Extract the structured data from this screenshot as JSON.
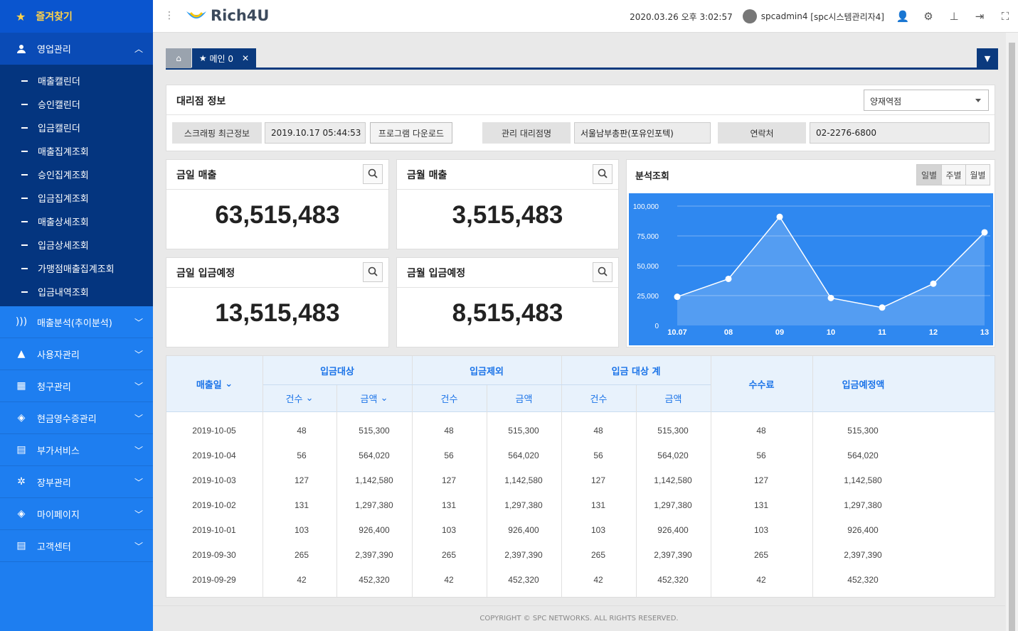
{
  "sidebar": {
    "favorites": "즐겨찾기",
    "sales": "영업관리",
    "sub": [
      "매출캘린더",
      "승인캘린더",
      "입금캘린더",
      "매출집계조회",
      "승인집계조회",
      "입금집계조회",
      "매출상세조회",
      "입금상세조회",
      "가맹점매출집계조회",
      "입금내역조회"
    ],
    "menus": [
      {
        "label": "매출분석(추이분석)",
        "icon": "signal-icon"
      },
      {
        "label": "사용자관리",
        "icon": "warning-icon"
      },
      {
        "label": "청구관리",
        "icon": "grid-icon"
      },
      {
        "label": "현금영수증관리",
        "icon": "tag-icon"
      },
      {
        "label": "부가서비스",
        "icon": "id-card-icon"
      },
      {
        "label": "장부관리",
        "icon": "gear-icon"
      },
      {
        "label": "마이페이지",
        "icon": "tag-icon"
      },
      {
        "label": "고객센터",
        "icon": "id-card-icon"
      }
    ]
  },
  "topbar": {
    "logo": "Rich4U",
    "datetime": "2020.03.26 오후 3:02:57",
    "user": "spcadmin4",
    "role": "[spc시스템관리자4]"
  },
  "tabs": {
    "main": "메인 0"
  },
  "agency": {
    "title": "대리점 정보",
    "select": "양재역점",
    "scrape_label": "스크래핑 최근정보",
    "scrape_value": "2019.10.17 05:44:53",
    "download": "프로그램 다운로드",
    "mgr_label": "관리 대리점명",
    "mgr_value": "서울남부총판(포유인포텍)",
    "contact_label": "연락처",
    "contact_value": "02-2276-6800"
  },
  "cards": [
    {
      "title": "금일 매출",
      "value": "63,515,483"
    },
    {
      "title": "금월 매출",
      "value": "3,515,483"
    },
    {
      "title": "금일 입금예정",
      "value": "13,515,483"
    },
    {
      "title": "금월 입금예정",
      "value": "8,515,483"
    }
  ],
  "analysis": {
    "title": "분석조회",
    "periods": [
      "일별",
      "주별",
      "월별"
    ]
  },
  "chart_data": {
    "type": "line",
    "categories": [
      "10.07",
      "08",
      "09",
      "10",
      "11",
      "12",
      "13"
    ],
    "values": [
      24000,
      39000,
      91000,
      23000,
      15000,
      35000,
      78000
    ],
    "ylim": [
      0,
      100000
    ],
    "yticks": [
      "100,000",
      "75,000",
      "50,000",
      "25,000",
      "0"
    ],
    "grid": true,
    "color": "#ffffff"
  },
  "table": {
    "headers": {
      "date": "매출일",
      "target": "입금대상",
      "excluded": "입금제외",
      "total": "입금 대상 계",
      "fee": "수수료",
      "expected": "입금예정액",
      "count": "건수",
      "amount": "금액"
    },
    "rows": [
      [
        "2019-10-05",
        "48",
        "515,300",
        "48",
        "515,300",
        "48",
        "515,300",
        "48",
        "515,300"
      ],
      [
        "2019-10-04",
        "56",
        "564,020",
        "56",
        "564,020",
        "56",
        "564,020",
        "56",
        "564,020"
      ],
      [
        "2019-10-03",
        "127",
        "1,142,580",
        "127",
        "1,142,580",
        "127",
        "1,142,580",
        "127",
        "1,142,580"
      ],
      [
        "2019-10-02",
        "131",
        "1,297,380",
        "131",
        "1,297,380",
        "131",
        "1,297,380",
        "131",
        "1,297,380"
      ],
      [
        "2019-10-01",
        "103",
        "926,400",
        "103",
        "926,400",
        "103",
        "926,400",
        "103",
        "926,400"
      ],
      [
        "2019-09-30",
        "265",
        "2,397,390",
        "265",
        "2,397,390",
        "265",
        "2,397,390",
        "265",
        "2,397,390"
      ],
      [
        "2019-09-29",
        "42",
        "452,320",
        "42",
        "452,320",
        "42",
        "452,320",
        "42",
        "452,320"
      ]
    ]
  },
  "footer": "COPYRIGHT © SPC NETWORKS. ALL RIGHTS RESERVED."
}
